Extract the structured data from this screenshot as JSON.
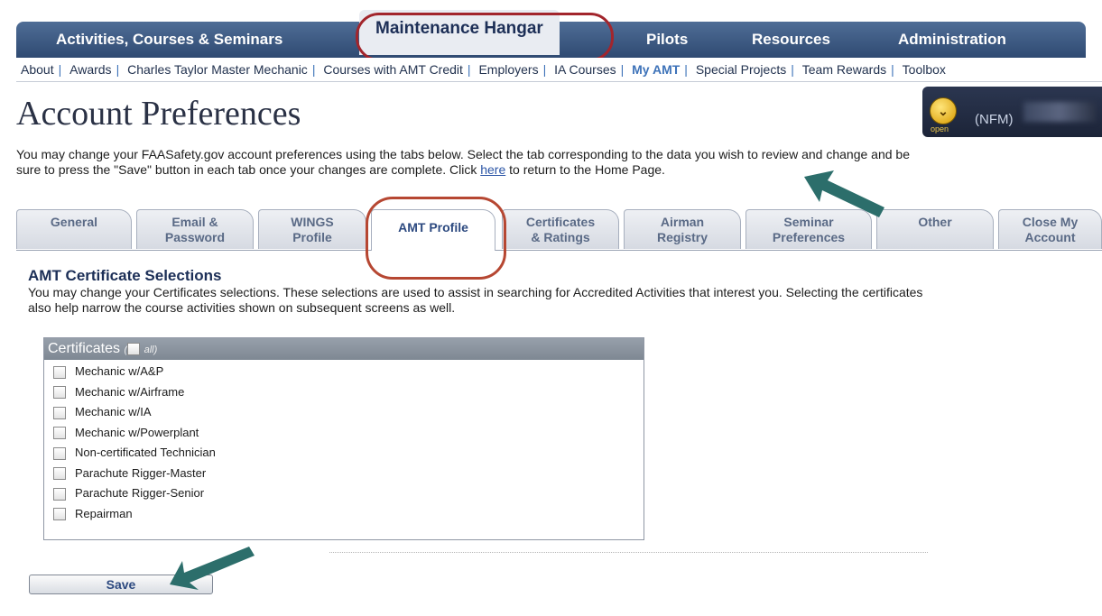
{
  "top_nav": {
    "items": [
      "Activities, Courses & Seminars",
      "Maintenance Hangar",
      "Pilots",
      "Resources",
      "Administration"
    ],
    "active_index": 1
  },
  "sub_nav": {
    "items": [
      "About",
      "Awards",
      "Charles Taylor Master Mechanic",
      "Courses with AMT Credit",
      "Employers",
      "IA Courses",
      "My AMT",
      "Special Projects",
      "Team Rewards",
      "Toolbox"
    ],
    "current": "My AMT"
  },
  "page_title": "Account Preferences",
  "user_box": {
    "badge_label": "open",
    "name": "(NFM)"
  },
  "intro": {
    "text_before_link": "You may change your FAASafety.gov account preferences using the tabs below. Select the tab corresponding to the data you wish to review and change and be sure to press the \"Save\" button in each tab once your changes are complete. Click",
    "link_text": "here",
    "text_after_link": "to return to the Home Page."
  },
  "tabs": [
    {
      "line1": "General",
      "line2": ""
    },
    {
      "line1": "Email &",
      "line2": "Password"
    },
    {
      "line1": "WINGS",
      "line2": "Profile"
    },
    {
      "line1": "AMT Profile",
      "line2": ""
    },
    {
      "line1": "Certificates",
      "line2": "& Ratings"
    },
    {
      "line1": "Airman",
      "line2": "Registry"
    },
    {
      "line1": "Seminar",
      "line2": "Preferences"
    },
    {
      "line1": "Other",
      "line2": ""
    },
    {
      "line1": "Close My",
      "line2": "Account"
    }
  ],
  "active_tab": "AMT Profile",
  "section": {
    "heading": "AMT Certificate Selections",
    "description_line1": "You may change your Certificates selections. These selections are used to assist in searching for Accredited Activities that interest you. Selecting the certificates",
    "description_line2": "also help narrow the course activities shown on subsequent screens as well."
  },
  "certificates": {
    "header": "Certificates",
    "all_label": "all",
    "items": [
      {
        "label": "Mechanic w/A&P",
        "checked": false
      },
      {
        "label": "Mechanic w/Airframe",
        "checked": false
      },
      {
        "label": "Mechanic w/IA",
        "checked": false
      },
      {
        "label": "Mechanic w/Powerplant",
        "checked": false
      },
      {
        "label": "Non-certificated Technician",
        "checked": false
      },
      {
        "label": "Parachute Rigger-Master",
        "checked": false
      },
      {
        "label": "Parachute Rigger-Senior",
        "checked": false
      },
      {
        "label": "Repairman",
        "checked": false
      }
    ]
  },
  "save_button": "Save",
  "colors": {
    "nav_bar": "#3a5680",
    "annotation_circle": "#a2252c",
    "annotation_arrow": "#2c6e6b",
    "link": "#2b55a6"
  }
}
